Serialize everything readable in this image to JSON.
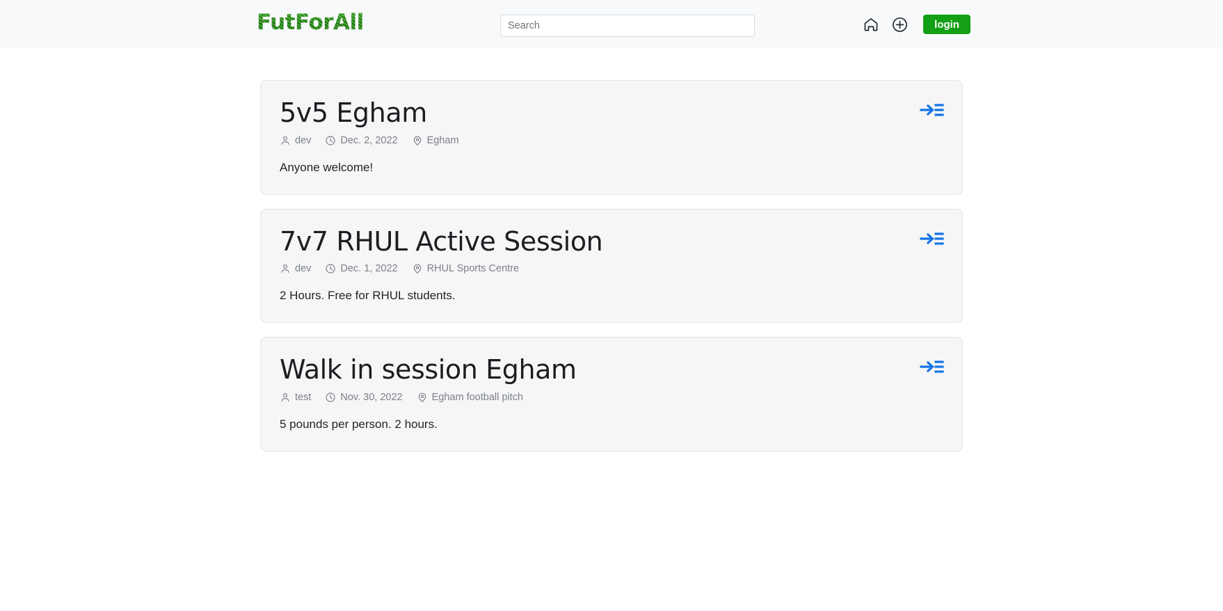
{
  "header": {
    "brand": "FutForAll",
    "search": {
      "placeholder": "Search",
      "value": ""
    },
    "home_icon": "home-icon",
    "add_icon": "plus-circle-icon",
    "login_label": "login"
  },
  "colors": {
    "header_bg": "#f8f9fa",
    "page_bg": "#ffffff",
    "card_bg": "#f6f6f7",
    "card_border": "#e3e4e6",
    "login_green": "#14a014",
    "brand_green": "#2f9e1f",
    "enter_blue": "#1275e6",
    "meta_text": "#7b8089",
    "title_text": "#1b1d21"
  },
  "cards": [
    {
      "title": "5v5 Egham",
      "author": "dev",
      "date": "Dec. 2, 2022",
      "location": "Egham",
      "description": "Anyone welcome!",
      "action_icon": "enter-session-icon"
    },
    {
      "title": "7v7 RHUL Active Session",
      "author": "dev",
      "date": "Dec. 1, 2022",
      "location": "RHUL Sports Centre",
      "description": "2 Hours. Free for RHUL students.",
      "action_icon": "enter-session-icon"
    },
    {
      "title": "Walk in session Egham",
      "author": "test",
      "date": "Nov. 30, 2022",
      "location": "Egham football pitch",
      "description": "5 pounds per person. 2 hours.",
      "action_icon": "enter-session-icon"
    }
  ]
}
